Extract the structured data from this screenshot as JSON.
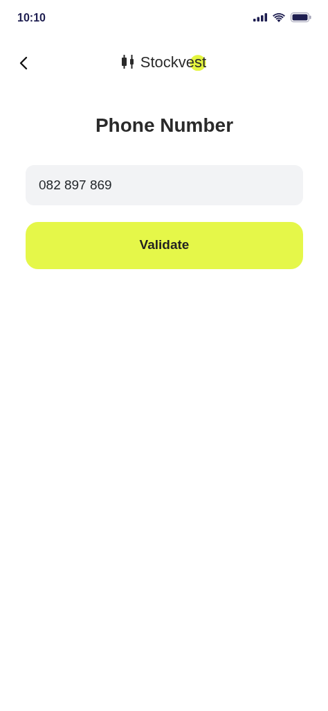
{
  "status_bar": {
    "time": "10:10"
  },
  "header": {
    "brand": "Stockvest"
  },
  "title": "Phone Number",
  "phone_field": {
    "value": "082 897 869"
  },
  "buttons": [
    "Validate"
  ]
}
